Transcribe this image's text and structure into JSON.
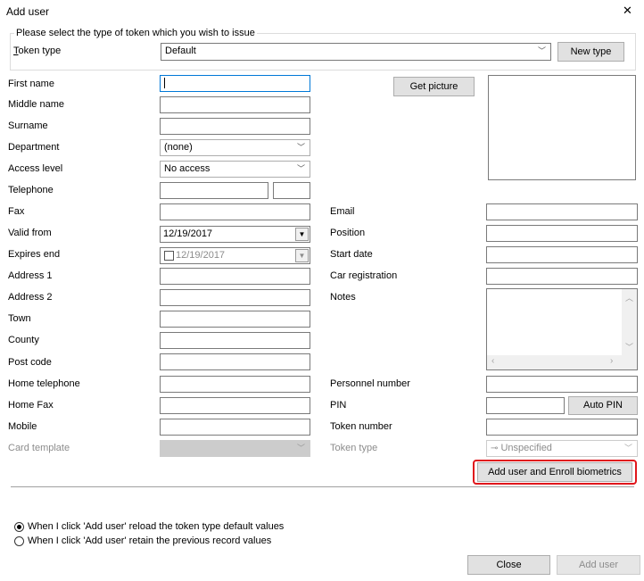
{
  "window": {
    "title": "Add user",
    "close_glyph": "✕"
  },
  "token_group": {
    "legend": "Please select the type of token which you wish to issue",
    "token_type_label_accel": "T",
    "token_type_label_rest": "oken type",
    "token_type_value": "Default",
    "new_type_label": "New type"
  },
  "labels": {
    "first_name": "First name",
    "middle_name": "Middle name",
    "surname": "Surname",
    "department": "Department",
    "access_level": "Access level",
    "telephone": "Telephone",
    "fax": "Fax",
    "valid_from": "Valid from",
    "expires_end": "Expires end",
    "address1": "Address 1",
    "address2": "Address 2",
    "town": "Town",
    "county": "County",
    "post_code": "Post code",
    "home_telephone": "Home telephone",
    "home_fax": "Home Fax",
    "mobile": "Mobile",
    "card_template": "Card template",
    "email": "Email",
    "position": "Position",
    "start_date": "Start date",
    "car_registration": "Car registration",
    "notes": "Notes",
    "personnel_number": "Personnel number",
    "pin": "PIN",
    "token_number": "Token number",
    "token_type": "Token type"
  },
  "values": {
    "department": "(none)",
    "access_level": "No access",
    "valid_from": "12/19/2017",
    "expires_end": "12/19/2017",
    "token_type": "Unspecified"
  },
  "buttons": {
    "get_picture": "Get picture",
    "auto_pin": "Auto PIN",
    "enroll": "Add user and Enroll biometrics",
    "close": "Close",
    "add_user": "Add user"
  },
  "options": {
    "reload": "When I click 'Add user' reload the token type default values",
    "retain": "When I click 'Add user' retain the previous record values",
    "selected": "reload"
  },
  "colors": {
    "highlight_border": "#e0161b",
    "focus_border": "#0078d7"
  }
}
